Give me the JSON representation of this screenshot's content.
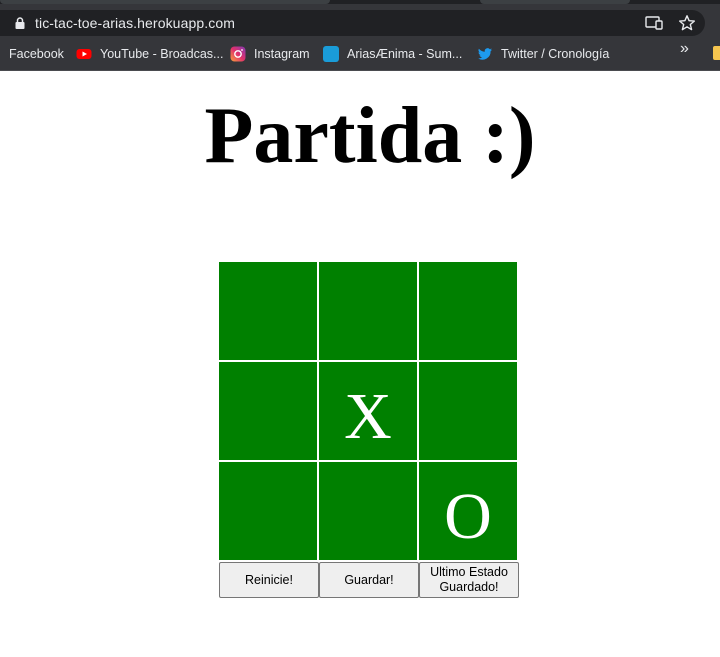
{
  "browser": {
    "url": "tic-tac-toe-arias.herokuapp.com",
    "icons": [
      "lock-icon",
      "cast-icon",
      "star-icon"
    ]
  },
  "bookmarks": [
    {
      "label": "Facebook",
      "icon": "facebook-icon"
    },
    {
      "label": "YouTube - Broadcas...",
      "icon": "youtube-icon",
      "color": "#ff0000"
    },
    {
      "label": "Instagram",
      "icon": "instagram-icon"
    },
    {
      "label": "AriasÆnima - Sum...",
      "icon": "ariasaenima-icon",
      "color": "#1a9cd8"
    },
    {
      "label": "Twitter / Cronología",
      "icon": "twitter-icon",
      "color": "#1d9bf0"
    }
  ],
  "bookmarks_overflow": "»",
  "page": {
    "title": "Partida :)"
  },
  "board": {
    "cell_color": "#008000",
    "cells": [
      "",
      "",
      "",
      "",
      "X",
      "",
      "",
      "",
      "O"
    ]
  },
  "buttons": {
    "reset": "Reinicie!",
    "save": "Guardar!",
    "last_state": "Ultimo Estado Guardado!"
  }
}
